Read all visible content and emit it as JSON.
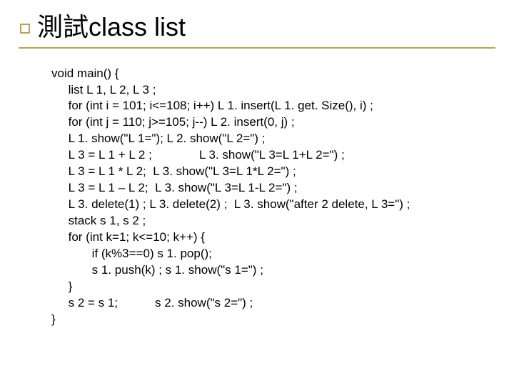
{
  "title": "測試class list",
  "code_lines": [
    "void main() {",
    "     list L 1, L 2, L 3 ;",
    "     for (int i = 101; i<=108; i++) L 1. insert(L 1. get. Size(), i) ;",
    "     for (int j = 110; j>=105; j--) L 2. insert(0, j) ;",
    "     L 1. show(\"L 1=\"); L 2. show(\"L 2=\") ;",
    "     L 3 = L 1 + L 2 ;              L 3. show(\"L 3=L 1+L 2=\") ;",
    "     L 3 = L 1 * L 2;  L 3. show(\"L 3=L 1*L 2=\") ;",
    "     L 3 = L 1 – L 2;  L 3. show(\"L 3=L 1-L 2=\") ;",
    "     L 3. delete(1) ; L 3. delete(2) ;  L 3. show(\"after 2 delete, L 3=\") ;",
    "     stack s 1, s 2 ;",
    "     for (int k=1; k<=10; k++) {",
    "            if (k%3==0) s 1. pop();",
    "            s 1. push(k) ; s 1. show(\"s 1=\") ;",
    "     }",
    "     s 2 = s 1;           s 2. show(\"s 2=\") ;",
    "}"
  ]
}
